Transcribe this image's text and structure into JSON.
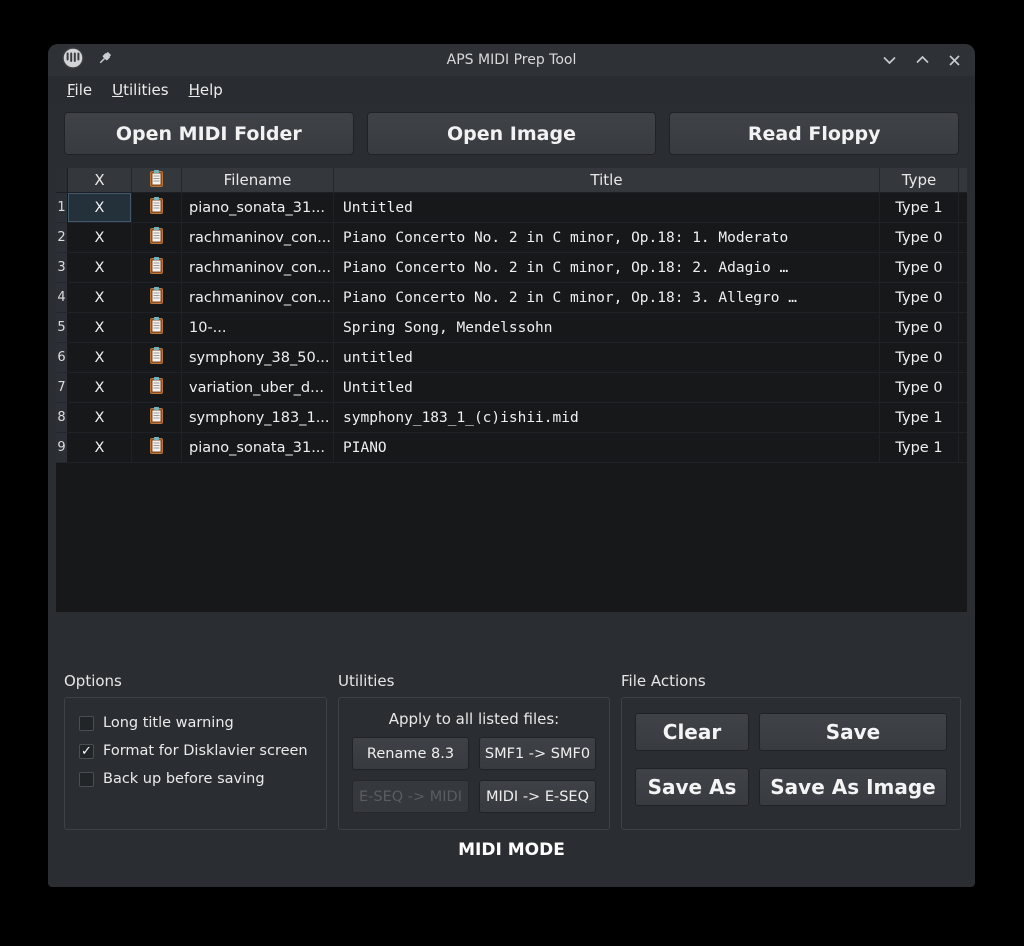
{
  "window": {
    "title": "APS MIDI Prep Tool",
    "menu": [
      {
        "label": "File"
      },
      {
        "label": "Utilities"
      },
      {
        "label": "Help"
      }
    ]
  },
  "toolbar": {
    "open_midi_folder": "Open MIDI Folder",
    "open_image": "Open Image",
    "read_floppy": "Read Floppy"
  },
  "table": {
    "headers": {
      "remove": "X",
      "filename": "Filename",
      "title": "Title",
      "type": "Type"
    },
    "rows": [
      {
        "num": "1",
        "remove": "X",
        "filename": "piano_sonata_31...",
        "title": "Untitled",
        "type": "Type 1",
        "selected": true
      },
      {
        "num": "2",
        "remove": "X",
        "filename": "rachmaninov_con...",
        "title": "Piano Concerto No. 2 in C minor, Op.18: 1. Moderato",
        "type": "Type 0"
      },
      {
        "num": "3",
        "remove": "X",
        "filename": "rachmaninov_con...",
        "title": "Piano Concerto No. 2 in C minor, Op.18: 2. Adagio …",
        "type": "Type 0"
      },
      {
        "num": "4",
        "remove": "X",
        "filename": "rachmaninov_con...",
        "title": "Piano Concerto No. 2 in C minor, Op.18: 3. Allegro …",
        "type": "Type 0"
      },
      {
        "num": "5",
        "remove": "X",
        "filename": "10-...",
        "title": "Spring Song, Mendelssohn",
        "type": "Type 0"
      },
      {
        "num": "6",
        "remove": "X",
        "filename": "symphony_38_50...",
        "title": "untitled",
        "type": "Type 0"
      },
      {
        "num": "7",
        "remove": "X",
        "filename": "variation_uber_d...",
        "title": "Untitled",
        "type": "Type 0"
      },
      {
        "num": "8",
        "remove": "X",
        "filename": "symphony_183_1...",
        "title": "symphony_183_1_(c)ishii.mid",
        "type": "Type 1"
      },
      {
        "num": "9",
        "remove": "X",
        "filename": "piano_sonata_31...",
        "title": "PIANO",
        "type": "Type 1"
      }
    ]
  },
  "options": {
    "title": "Options",
    "checkboxes": [
      {
        "label": "Long title warning",
        "checked": false
      },
      {
        "label": "Format for Disklavier screen",
        "checked": true
      },
      {
        "label": "Back up before saving",
        "checked": false
      }
    ]
  },
  "utilities": {
    "title": "Utilities",
    "caption": "Apply to all listed files:",
    "buttons": [
      {
        "label": "Rename 8.3",
        "enabled": true
      },
      {
        "label": "SMF1 -> SMF0",
        "enabled": true
      },
      {
        "label": "E-SEQ -> MIDI",
        "enabled": false
      },
      {
        "label": "MIDI -> E-SEQ",
        "enabled": true
      }
    ]
  },
  "file_actions": {
    "title": "File Actions",
    "buttons": {
      "clear": "Clear",
      "save": "Save",
      "save_as": "Save As",
      "save_as_image": "Save As Image"
    }
  },
  "status": {
    "mode": "MIDI MODE"
  },
  "icons": {
    "app": "aps-logo-icon",
    "pin": "pin-icon",
    "minimize": "chevron-down-icon",
    "maximize": "chevron-up-icon",
    "close": "close-icon",
    "clipboard": "clipboard-icon",
    "check_glyph": "✓"
  },
  "colors": {
    "window_bg": "#2a2e32",
    "titlebar_bg": "#2e3237",
    "table_bg": "#16181a",
    "header_bg": "#34383d",
    "button_bg": "#3b3f44",
    "clipboard_orange": "#bf7334",
    "clipboard_clip_teal": "#6fb3bd",
    "selected_cell_border": "#41596a"
  }
}
